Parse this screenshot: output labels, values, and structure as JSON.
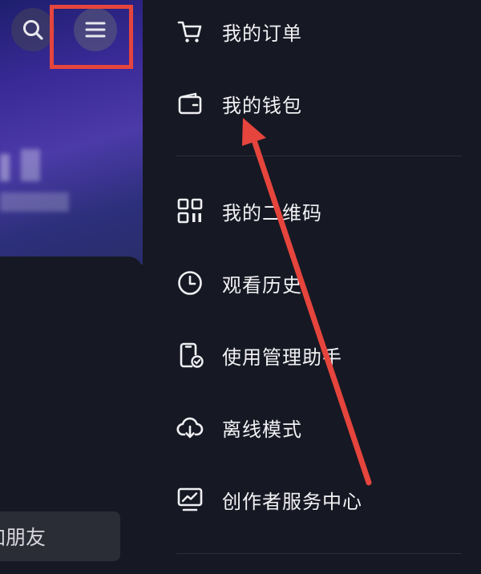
{
  "left_panel": {
    "friend_input_text": "加朋友",
    "annotation_color": "#e5453d"
  },
  "drawer": {
    "items": [
      {
        "label": "我的订单",
        "icon": "shopping-cart-icon"
      },
      {
        "label": "我的钱包",
        "icon": "wallet-icon"
      },
      {
        "label": "我的二维码",
        "icon": "qr-code-icon"
      },
      {
        "label": "观看历史",
        "icon": "clock-icon"
      },
      {
        "label": "使用管理助手",
        "icon": "phone-check-icon"
      },
      {
        "label": "离线模式",
        "icon": "cloud-download-icon"
      },
      {
        "label": "创作者服务中心",
        "icon": "monitor-chart-icon"
      }
    ]
  }
}
